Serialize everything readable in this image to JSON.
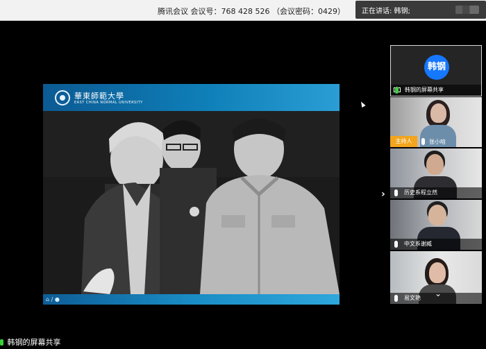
{
  "topbar": {
    "meeting_info": "腾讯会议 会议号：768 428 526 （会议密码：0429）",
    "speaking": "正在讲话: 韩钢;"
  },
  "slide": {
    "university_cn": "華東師範大學",
    "university_en": "EAST CHINA NORMAL UNIVERSITY"
  },
  "share": {
    "label": "韩钢的屏幕共享"
  },
  "participants": [
    {
      "avatar_text": "韩钢",
      "label": "韩钢的屏幕共享"
    },
    {
      "role": "主持人",
      "label": "张小晗"
    },
    {
      "label": "历史系程立然"
    },
    {
      "label": "中文系谢臧"
    },
    {
      "label": "易文艳"
    }
  ],
  "icons": [
    "speaker-bars-icon",
    "university-emblem-icon",
    "mic-icon",
    "screen-share-icon",
    "chevron-right-icon",
    "chevron-down-icon"
  ]
}
